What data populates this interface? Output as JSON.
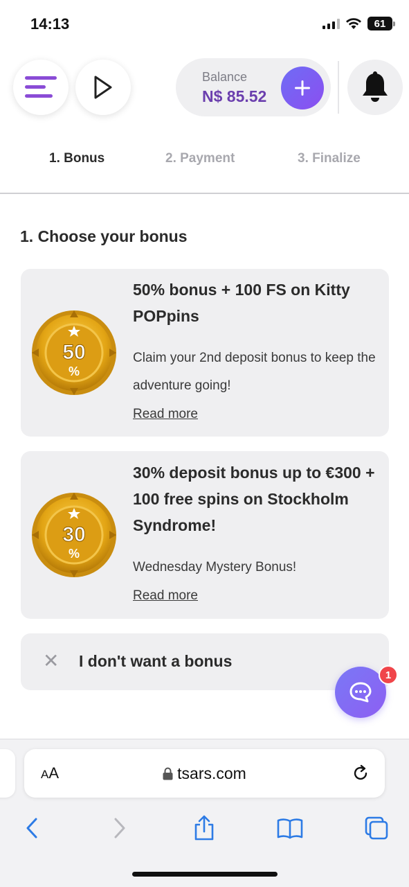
{
  "status_bar": {
    "time": "14:13",
    "battery": "61"
  },
  "header": {
    "balance_label": "Balance",
    "balance_value": "N$ 85.52",
    "accent_color": "#6b3fae"
  },
  "steps": [
    {
      "label": "1. Bonus",
      "active": true
    },
    {
      "label": "2. Payment",
      "active": false
    },
    {
      "label": "3. Finalize",
      "active": false
    }
  ],
  "section_title": "1. Choose your bonus",
  "bonuses": [
    {
      "badge_value": "50",
      "badge_unit": "%",
      "title": "50% bonus + 100 FS on Kitty POPpins",
      "description": "Claim your 2nd deposit bonus to keep the adventure going!",
      "read_more": "Read more"
    },
    {
      "badge_value": "30",
      "badge_unit": "%",
      "title": "30% deposit bonus up to €300 + 100 free spins on Stockholm Syndrome!",
      "description": "Wednesday Mystery Bonus!",
      "read_more": "Read more"
    }
  ],
  "no_bonus": {
    "label": "I don't want a bonus"
  },
  "chat": {
    "badge_count": "1"
  },
  "browser": {
    "aa_label_big": "A",
    "aa_label_small": "A",
    "url": "tsars.com"
  }
}
